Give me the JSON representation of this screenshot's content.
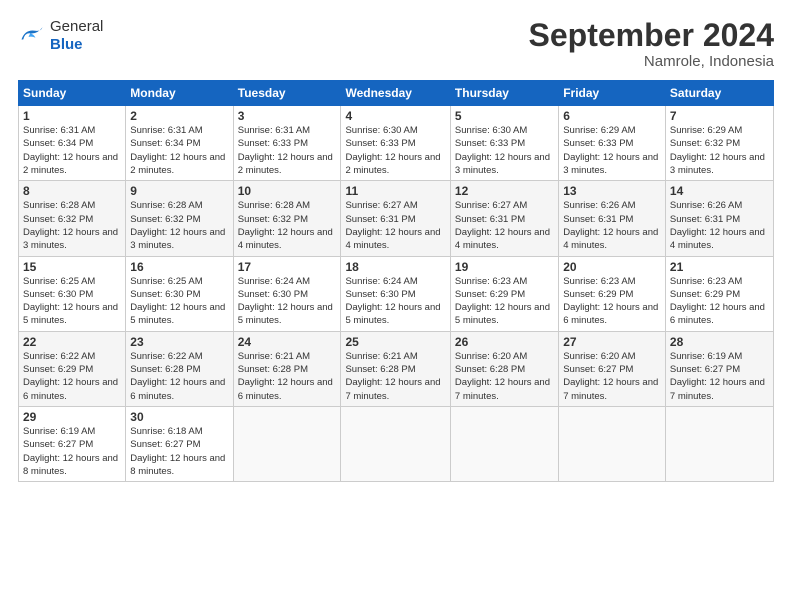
{
  "header": {
    "logo_general": "General",
    "logo_blue": "Blue",
    "month_title": "September 2024",
    "location": "Namrole, Indonesia"
  },
  "weekdays": [
    "Sunday",
    "Monday",
    "Tuesday",
    "Wednesday",
    "Thursday",
    "Friday",
    "Saturday"
  ],
  "weeks": [
    [
      {
        "day": "1",
        "sunrise": "6:31 AM",
        "sunset": "6:34 PM",
        "daylight": "12 hours and 2 minutes."
      },
      {
        "day": "2",
        "sunrise": "6:31 AM",
        "sunset": "6:34 PM",
        "daylight": "12 hours and 2 minutes."
      },
      {
        "day": "3",
        "sunrise": "6:31 AM",
        "sunset": "6:33 PM",
        "daylight": "12 hours and 2 minutes."
      },
      {
        "day": "4",
        "sunrise": "6:30 AM",
        "sunset": "6:33 PM",
        "daylight": "12 hours and 2 minutes."
      },
      {
        "day": "5",
        "sunrise": "6:30 AM",
        "sunset": "6:33 PM",
        "daylight": "12 hours and 3 minutes."
      },
      {
        "day": "6",
        "sunrise": "6:29 AM",
        "sunset": "6:33 PM",
        "daylight": "12 hours and 3 minutes."
      },
      {
        "day": "7",
        "sunrise": "6:29 AM",
        "sunset": "6:32 PM",
        "daylight": "12 hours and 3 minutes."
      }
    ],
    [
      {
        "day": "8",
        "sunrise": "6:28 AM",
        "sunset": "6:32 PM",
        "daylight": "12 hours and 3 minutes."
      },
      {
        "day": "9",
        "sunrise": "6:28 AM",
        "sunset": "6:32 PM",
        "daylight": "12 hours and 3 minutes."
      },
      {
        "day": "10",
        "sunrise": "6:28 AM",
        "sunset": "6:32 PM",
        "daylight": "12 hours and 4 minutes."
      },
      {
        "day": "11",
        "sunrise": "6:27 AM",
        "sunset": "6:31 PM",
        "daylight": "12 hours and 4 minutes."
      },
      {
        "day": "12",
        "sunrise": "6:27 AM",
        "sunset": "6:31 PM",
        "daylight": "12 hours and 4 minutes."
      },
      {
        "day": "13",
        "sunrise": "6:26 AM",
        "sunset": "6:31 PM",
        "daylight": "12 hours and 4 minutes."
      },
      {
        "day": "14",
        "sunrise": "6:26 AM",
        "sunset": "6:31 PM",
        "daylight": "12 hours and 4 minutes."
      }
    ],
    [
      {
        "day": "15",
        "sunrise": "6:25 AM",
        "sunset": "6:30 PM",
        "daylight": "12 hours and 5 minutes."
      },
      {
        "day": "16",
        "sunrise": "6:25 AM",
        "sunset": "6:30 PM",
        "daylight": "12 hours and 5 minutes."
      },
      {
        "day": "17",
        "sunrise": "6:24 AM",
        "sunset": "6:30 PM",
        "daylight": "12 hours and 5 minutes."
      },
      {
        "day": "18",
        "sunrise": "6:24 AM",
        "sunset": "6:30 PM",
        "daylight": "12 hours and 5 minutes."
      },
      {
        "day": "19",
        "sunrise": "6:23 AM",
        "sunset": "6:29 PM",
        "daylight": "12 hours and 5 minutes."
      },
      {
        "day": "20",
        "sunrise": "6:23 AM",
        "sunset": "6:29 PM",
        "daylight": "12 hours and 6 minutes."
      },
      {
        "day": "21",
        "sunrise": "6:23 AM",
        "sunset": "6:29 PM",
        "daylight": "12 hours and 6 minutes."
      }
    ],
    [
      {
        "day": "22",
        "sunrise": "6:22 AM",
        "sunset": "6:29 PM",
        "daylight": "12 hours and 6 minutes."
      },
      {
        "day": "23",
        "sunrise": "6:22 AM",
        "sunset": "6:28 PM",
        "daylight": "12 hours and 6 minutes."
      },
      {
        "day": "24",
        "sunrise": "6:21 AM",
        "sunset": "6:28 PM",
        "daylight": "12 hours and 6 minutes."
      },
      {
        "day": "25",
        "sunrise": "6:21 AM",
        "sunset": "6:28 PM",
        "daylight": "12 hours and 7 minutes."
      },
      {
        "day": "26",
        "sunrise": "6:20 AM",
        "sunset": "6:28 PM",
        "daylight": "12 hours and 7 minutes."
      },
      {
        "day": "27",
        "sunrise": "6:20 AM",
        "sunset": "6:27 PM",
        "daylight": "12 hours and 7 minutes."
      },
      {
        "day": "28",
        "sunrise": "6:19 AM",
        "sunset": "6:27 PM",
        "daylight": "12 hours and 7 minutes."
      }
    ],
    [
      {
        "day": "29",
        "sunrise": "6:19 AM",
        "sunset": "6:27 PM",
        "daylight": "12 hours and 8 minutes."
      },
      {
        "day": "30",
        "sunrise": "6:18 AM",
        "sunset": "6:27 PM",
        "daylight": "12 hours and 8 minutes."
      },
      null,
      null,
      null,
      null,
      null
    ]
  ]
}
